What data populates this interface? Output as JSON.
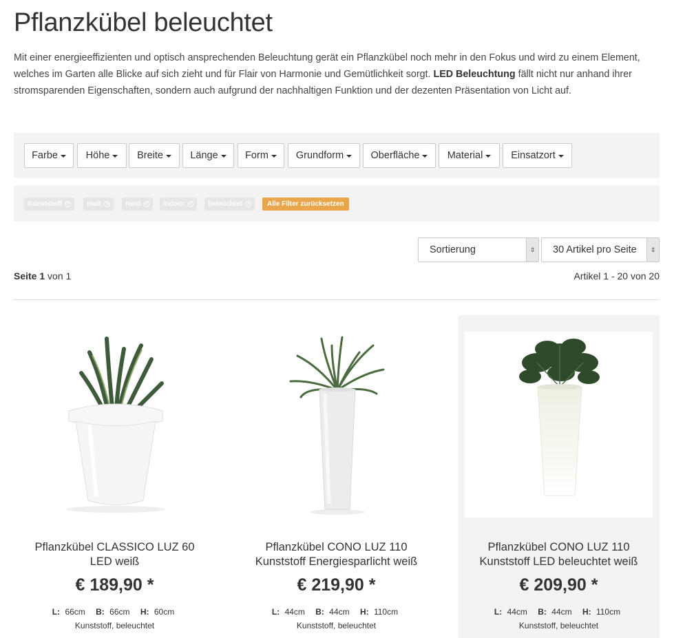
{
  "page": {
    "title": "Pflanzkübel beleuchtet",
    "intro_part1": "Mit einer energieeffizienten und optisch ansprechenden Beleuchtung gerät ein Pflanzkübel noch mehr in den Fokus und wird zu einem Element, welches im Garten alle Blicke auf sich zieht und für Flair von Harmonie und Gemütlichkeit sorgt. ",
    "intro_bold": "LED Beleuchtung",
    "intro_part2": " fällt nicht nur anhand ihrer stromsparenden Eigenschaften, sondern auch aufgrund der nachhaltigen Funktion und der dezenten Präsentation von Licht auf."
  },
  "filters": {
    "farbe": "Farbe",
    "hoehe": "Höhe",
    "breite": "Breite",
    "laenge": "Länge",
    "form": "Form",
    "grundform": "Grundform",
    "oberflaeche": "Oberfläche",
    "material": "Material",
    "einsatzort": "Einsatzort"
  },
  "active_filters": {
    "chips": [
      "Kunststoff",
      "matt",
      "rund",
      "indoor",
      "beleuchtet"
    ],
    "reset_label": "Alle Filter zurücksetzen"
  },
  "sorting": {
    "sort_label": "Sortierung",
    "per_page_label": "30 Artikel pro Seite"
  },
  "pagination": {
    "page_word": "Seite",
    "page_current": "1",
    "page_of": "von 1",
    "articles": "Artikel 1 - 20 von 20"
  },
  "products": [
    {
      "name": "Pflanzkübel CLASSICO LUZ 60 LED weiß",
      "price": "€ 189,90 *",
      "l_label": "L:",
      "l_value": "66cm",
      "b_label": "B:",
      "b_value": "66cm",
      "h_label": "H:",
      "h_value": "60cm",
      "material": "Kunststoff, beleuchtet"
    },
    {
      "name": "Pflanzkübel CONO LUZ 110 Kunststoff Energiesparlicht weiß",
      "price": "€ 219,90 *",
      "l_label": "L:",
      "l_value": "44cm",
      "b_label": "B:",
      "b_value": "44cm",
      "h_label": "H:",
      "h_value": "110cm",
      "material": "Kunststoff, beleuchtet"
    },
    {
      "name": "Pflanzkübel CONO LUZ 110 Kunststoff LED beleuchtet weiß",
      "price": "€ 209,90 *",
      "l_label": "L:",
      "l_value": "44cm",
      "b_label": "B:",
      "b_value": "44cm",
      "h_label": "H:",
      "h_value": "110cm",
      "material": "Kunststoff, beleuchtet"
    }
  ],
  "colors": {
    "accent_reset": "#e9a54a",
    "filter_bg": "#f4f3f3",
    "text": "#333333"
  }
}
